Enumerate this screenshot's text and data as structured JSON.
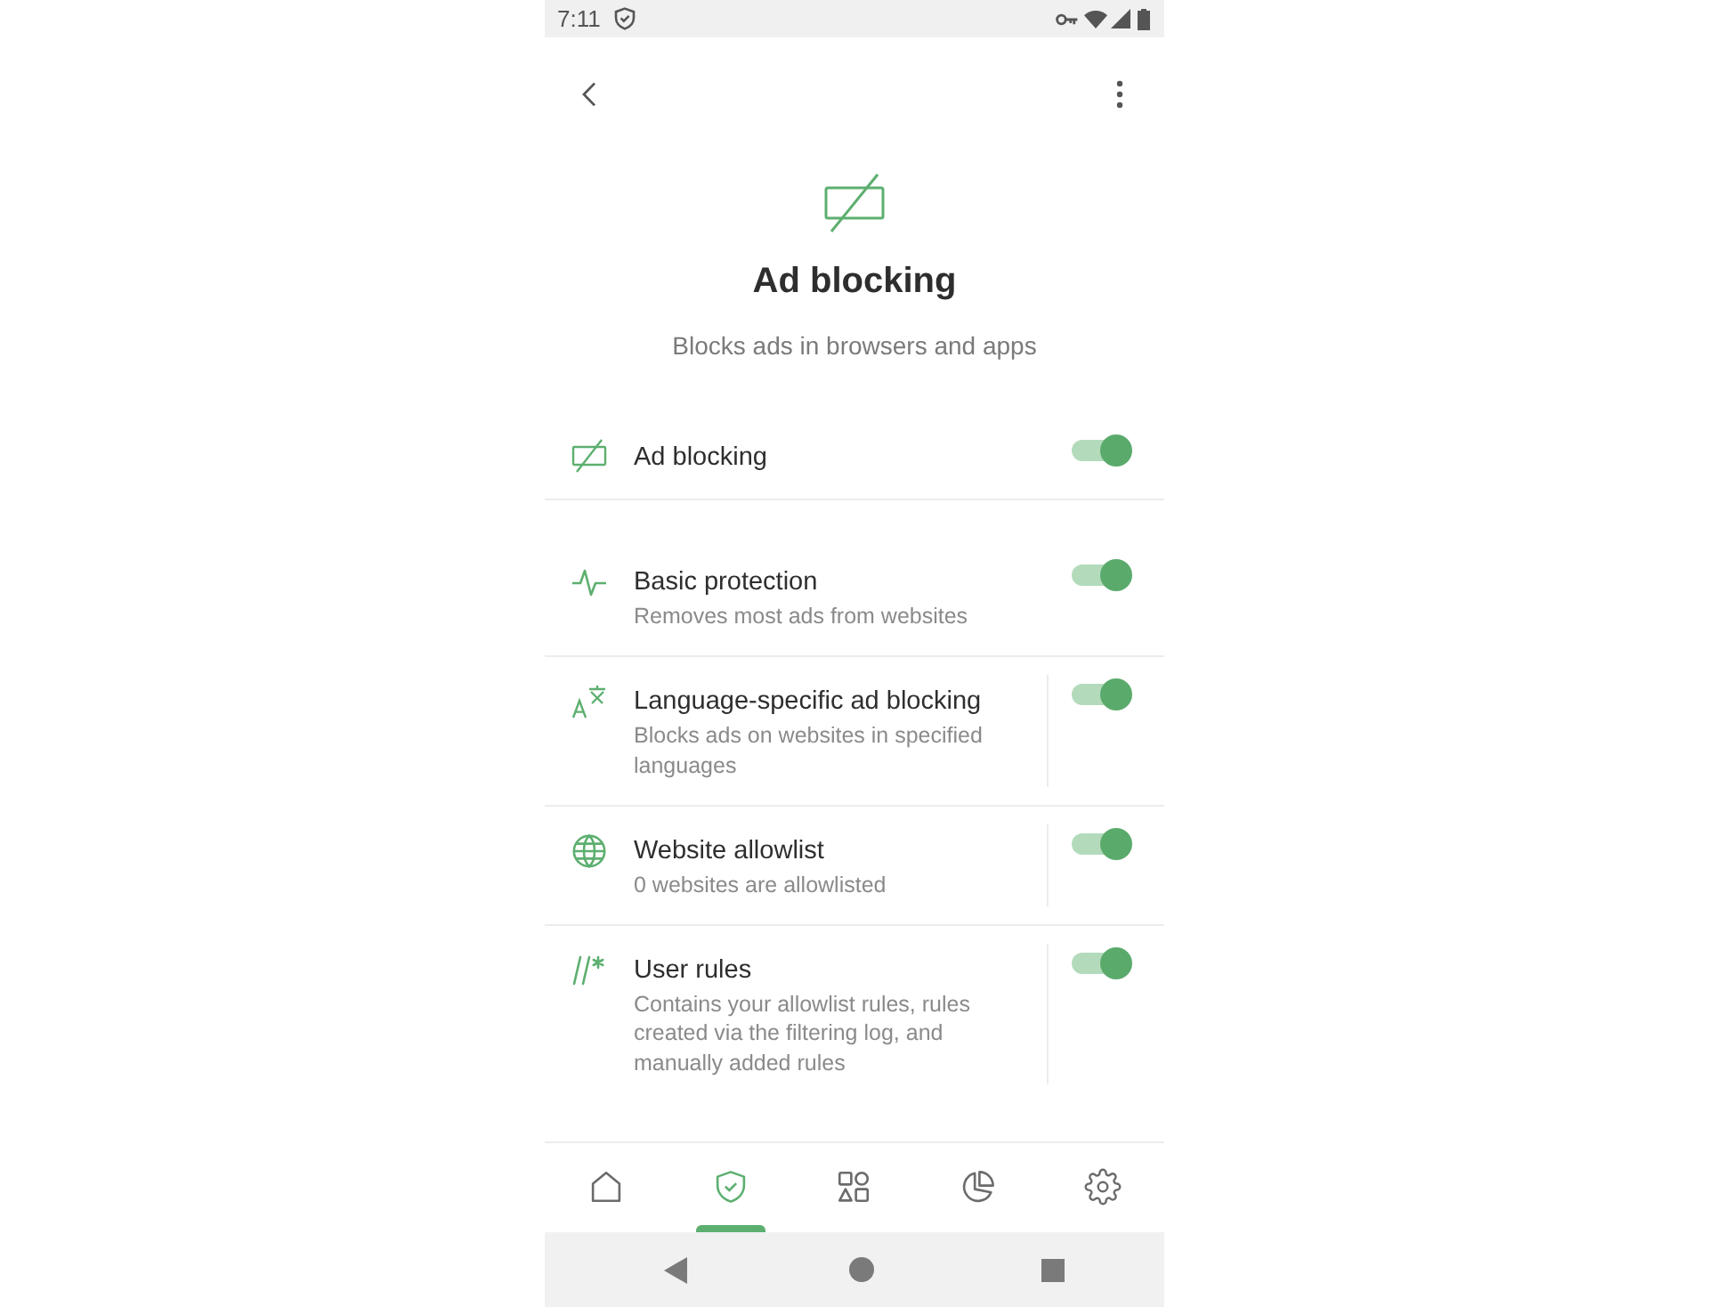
{
  "status_bar": {
    "time": "7:11"
  },
  "hero": {
    "title": "Ad blocking",
    "subtitle": "Blocks ads in browsers and apps"
  },
  "master_switch": {
    "label": "Ad blocking",
    "on": true
  },
  "settings": [
    {
      "kind": "toggle",
      "title": "Basic protection",
      "subtitle": "Removes most ads from websites",
      "on": true
    },
    {
      "kind": "toggle_link",
      "title": "Language-specific ad blocking",
      "subtitle": "Blocks ads on websites in specified languages",
      "on": true
    },
    {
      "kind": "toggle_link",
      "title": "Website allowlist",
      "subtitle": "0 websites are allowlisted",
      "on": true
    },
    {
      "kind": "toggle_link",
      "title": "User rules",
      "subtitle": "Contains your allowlist rules, rules created via the filtering log, and manually added rules",
      "on": true
    }
  ],
  "bottom_nav": [
    {
      "selected": false
    },
    {
      "selected": true
    },
    {
      "selected": false
    },
    {
      "selected": false
    },
    {
      "selected": false
    }
  ]
}
